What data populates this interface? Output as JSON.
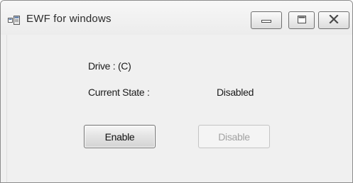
{
  "window": {
    "title": "EWF for windows",
    "controls": {
      "minimize": "minimize-icon",
      "maximize": "maximize-icon",
      "close": "close-icon"
    }
  },
  "form": {
    "drive_label": "Drive : (C)",
    "state_label": "Current State :",
    "state_value": "Disabled",
    "enable_button": "Enable",
    "disable_button": "Disable",
    "disable_enabled": false
  },
  "colors": {
    "window_bg": "#f0f0f0",
    "disabled_text": "#a2a2a2"
  }
}
